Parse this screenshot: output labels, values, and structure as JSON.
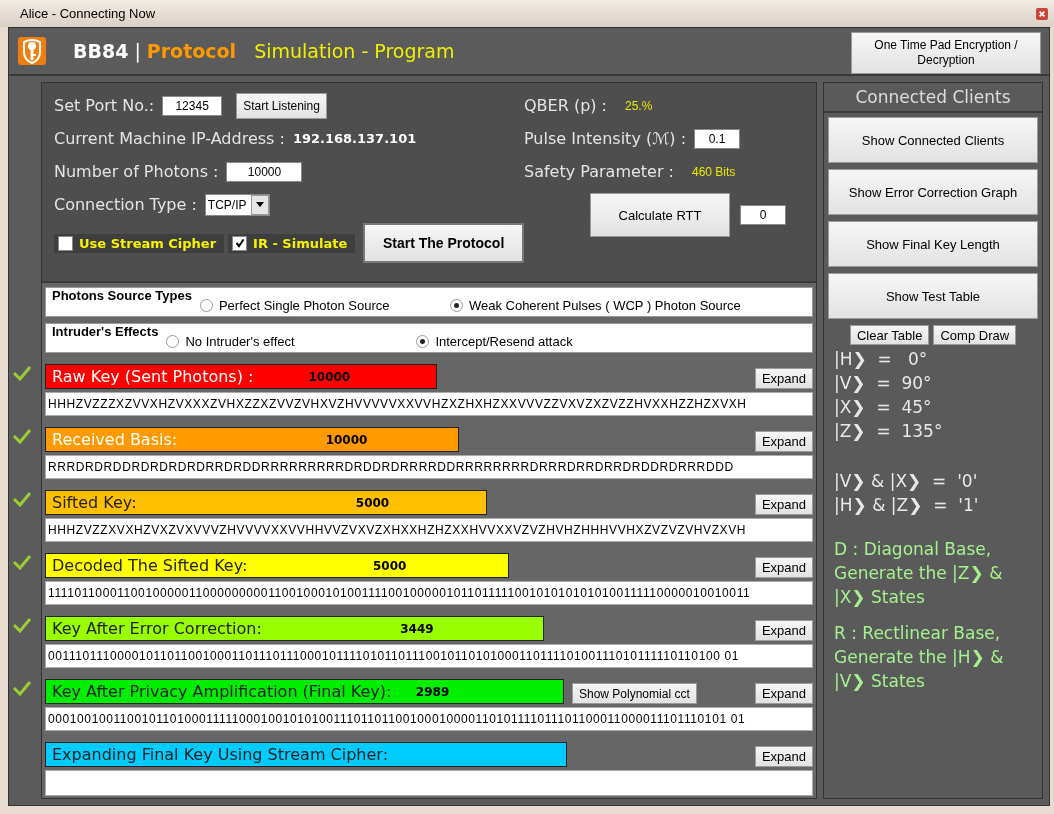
{
  "window": {
    "title": "Alice - Connecting Now"
  },
  "header": {
    "brand": "BB84",
    "separator": "|",
    "protocol": "Protocol",
    "subtitle": "Simulation - Program",
    "otp_button": "One Time Pad Encryption / Decryption"
  },
  "settings": {
    "port_label": "Set Port No.:",
    "port_value": "12345",
    "start_listening": "Start Listening",
    "ip_label": "Current Machine IP-Address :",
    "ip_value": "192.168.137.101",
    "photons_label": "Number of Photons :",
    "photons_value": "10000",
    "connection_label": "Connection Type :",
    "connection_value": "TCP/IP",
    "qber_label": "QBER (p) :",
    "qber_value": "25.%",
    "pulse_label": "Pulse Intensity (ℳ) :",
    "pulse_value": "0.1",
    "safety_label": "Safety Parameter :",
    "safety_value": "460 Bits",
    "start_protocol": "Start The Protocol",
    "calculate_rtt": "Calculate RTT",
    "rtt_value": "0",
    "checkboxes": [
      {
        "label": "Use Stream Cipher",
        "checked": false
      },
      {
        "label": "IR - Simulate",
        "checked": true
      }
    ]
  },
  "radio_groups": [
    {
      "title": "Photons Source Types",
      "options": [
        {
          "label": "Perfect Single Photon Source",
          "selected": false
        },
        {
          "label": "Weak Coherent Pulses ( WCP ) Photon Source",
          "selected": true
        }
      ]
    },
    {
      "title": "Intruder's Effects",
      "options": [
        {
          "label": "No Intruder's effect",
          "selected": false
        },
        {
          "label": "Intercept/Resend  attack",
          "selected": true
        }
      ]
    }
  ],
  "keys": [
    {
      "label": "Raw Key (Sent Photons) :",
      "count": "10000",
      "color": "#ff0000",
      "done": true,
      "value": "HHHZVZZZXZVVXHZVXXXZVHXZZXZVVZVHXVZHVVVVVXXVVHZXZHXHZXXVVVZZVXVZXZVZZHVXXHZZHZXVXH",
      "expand": "Expand"
    },
    {
      "label": "Received Basis:",
      "count": "10000",
      "color": "#ff9900",
      "done": true,
      "value": "RRRDRDRDDRDRDRDRDRRDRDDRRRRRRRRRDRDDRDRRRRDDRRRRRRRRDRRRDRRDRRDRDDRDRRRDDD",
      "expand": "Expand"
    },
    {
      "label": "Sifted Key:",
      "count": "5000",
      "color": "#ffc000",
      "done": true,
      "value": "HHHZVZZXVXHZVXZVXVVVZHVVVVXXVVHHVVZVXVZXHXXHZHZXXHVVXXVZVZHVHZHHHVVHXZVZVZVHVZXVH",
      "expand": "Expand"
    },
    {
      "label": "Decoded The Sifted Key:",
      "count": "5000",
      "color": "#ffff00",
      "done": true,
      "value": "111101100011001000001100000000011001000101001111001000001011011111001010101010100111110000010010011",
      "expand": "Expand"
    },
    {
      "label": "Key After Error Correction:",
      "count": "3449",
      "color": "#99ff00",
      "done": true,
      "value": "001110111000010110110010001101110111000101111010110111001011010100011011110100111010111110110100 01",
      "expand": "Expand"
    },
    {
      "label": "Key After Privacy Amplification (Final Key):",
      "count": "2989",
      "color": "#00ee00",
      "done": true,
      "extra_button": "Show Polynomial cct",
      "value": "000100100110010110100011111000100101010011101101100100010000110101111011101100011000011101110101 01",
      "expand": "Expand"
    },
    {
      "label": "Expanding Final Key Using Stream Cipher:",
      "color": "#00ccff",
      "done": false,
      "expand": "Expand"
    }
  ],
  "sidebar": {
    "title": "Connected Clients",
    "buttons": [
      "Show Connected Clients",
      "Show Error Correction Graph",
      "Show Final Key Length",
      "Show Test Table"
    ],
    "small_buttons": [
      "Clear Table",
      "Comp Draw"
    ],
    "states": [
      "|H❯  =   0°",
      "|V❯  =  90°",
      "|X❯  =  45°",
      "|Z❯  =  135°"
    ],
    "bits": [
      "|V❯ & |X❯  =  '0'",
      "|H❯ & |Z❯  =  '1'"
    ],
    "notes": [
      "D : Diagonal Base, Generate the |Z❯ & |X❯  States",
      "R : Rectlinear Base, Generate the |H❯ & |V❯  States"
    ]
  }
}
